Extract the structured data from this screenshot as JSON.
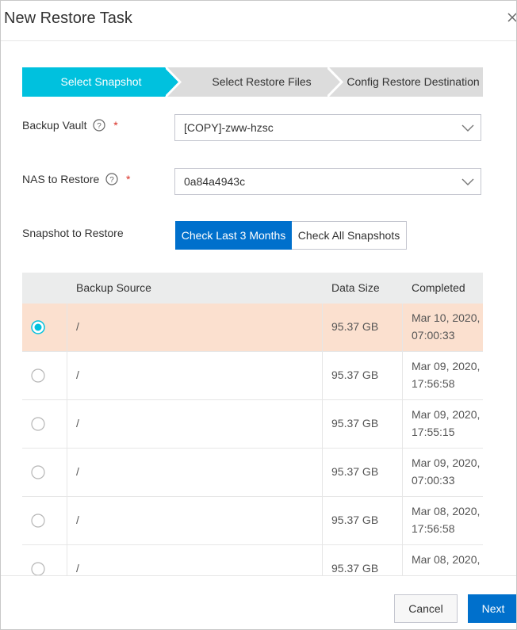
{
  "dialog": {
    "title": "New Restore Task",
    "close_icon": "close-icon"
  },
  "steps": [
    {
      "label": "Select Snapshot",
      "active": true
    },
    {
      "label": "Select Restore Files",
      "active": false
    },
    {
      "label": "Config Restore Destination",
      "active": false
    }
  ],
  "form": {
    "backup_vault": {
      "label": "Backup Vault",
      "value": "[COPY]-zww-hzsc"
    },
    "nas_to_restore": {
      "label": "NAS to Restore",
      "value": "0a84a4943c"
    },
    "snapshot_to_restore": {
      "label": "Snapshot to Restore",
      "option_last_3_months": "Check Last 3 Months",
      "option_all": "Check All Snapshots"
    }
  },
  "table": {
    "headers": {
      "source": "Backup Source",
      "size": "Data Size",
      "completed": "Completed"
    },
    "rows": [
      {
        "source": "/",
        "size": "95.37 GB",
        "date": "Mar 10, 2020,",
        "time": "07:00:33",
        "selected": true
      },
      {
        "source": "/",
        "size": "95.37 GB",
        "date": "Mar 09, 2020,",
        "time": "17:56:58",
        "selected": false
      },
      {
        "source": "/",
        "size": "95.37 GB",
        "date": "Mar 09, 2020,",
        "time": "17:55:15",
        "selected": false
      },
      {
        "source": "/",
        "size": "95.37 GB",
        "date": "Mar 09, 2020,",
        "time": "07:00:33",
        "selected": false
      },
      {
        "source": "/",
        "size": "95.37 GB",
        "date": "Mar 08, 2020,",
        "time": "17:56:58",
        "selected": false
      },
      {
        "source": "/",
        "size": "95.37 GB",
        "date": "Mar 08, 2020,",
        "time": "",
        "selected": false
      }
    ]
  },
  "footer": {
    "cancel": "Cancel",
    "next": "Next"
  },
  "colors": {
    "step_active": "#00c1de",
    "step_inactive": "#dcdcdc",
    "primary": "#0070cc",
    "selected_row": "#fbe0cf"
  }
}
